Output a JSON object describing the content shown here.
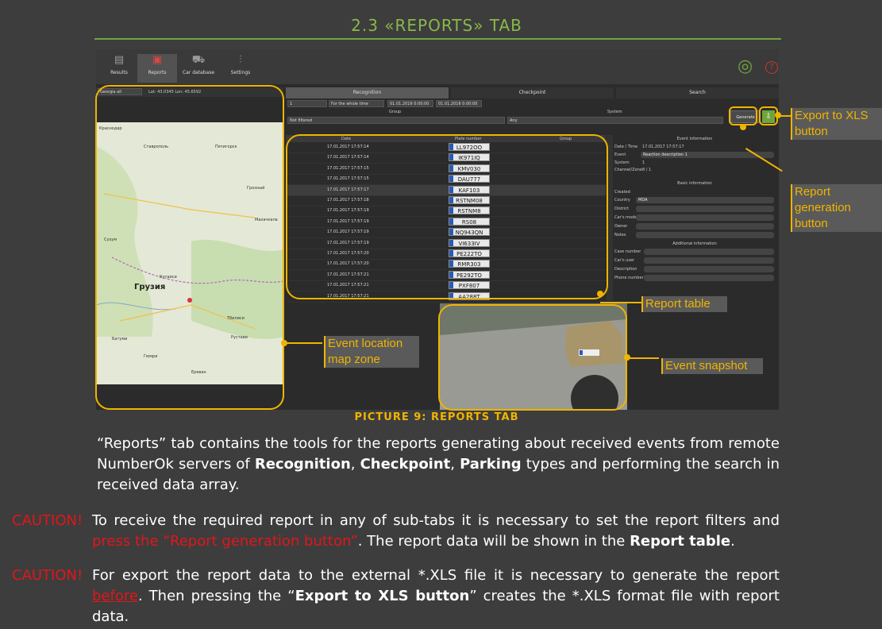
{
  "heading": "2.3 «REPORTS» TAB",
  "toolbar": {
    "items": [
      "Results",
      "Reports",
      "Car database",
      "Settings"
    ]
  },
  "map": {
    "region_select": "Georgia all",
    "coords": "Lat: 43.0345 Lon: 45.6592",
    "city_label": "Грузия",
    "places": [
      "Краснодар",
      "Ставрополь",
      "Пятигорск",
      "Грозный",
      "Махачкала",
      "Сухум",
      "Кутаиси",
      "Тбилиси",
      "Батуми",
      "Рустави",
      "Ереван",
      "Гюмри"
    ]
  },
  "tabs": [
    "Recognition",
    "Checkpoint",
    "Search"
  ],
  "filters": {
    "camera": "1",
    "period": "For the whole time",
    "date_from": "01.01.2016 0:00:00",
    "date_to": "01.01.2016 0:00:00",
    "group_label": "Group",
    "group_value": "Not filtered",
    "system_label": "System",
    "system_value": "Any",
    "generate_label": "Generate"
  },
  "table": {
    "columns": [
      "Date",
      "Plate number",
      "Group"
    ],
    "rows": [
      {
        "date": "17.01.2017 17:57:14",
        "plate": "LL972OO"
      },
      {
        "date": "17.01.2017 17:57:14",
        "plate": "IK971IQ"
      },
      {
        "date": "17.01.2017 17:57:15",
        "plate": "KMV030"
      },
      {
        "date": "17.01.2017 17:57:15",
        "plate": "DAU777"
      },
      {
        "date": "17.01.2017 17:57:17",
        "plate": "KAF103"
      },
      {
        "date": "17.01.2017 17:57:18",
        "plate": "RSTNM08"
      },
      {
        "date": "17.01.2017 17:57:19",
        "plate": "RSTNM8"
      },
      {
        "date": "17.01.2017 17:57:19",
        "plate": "RS08"
      },
      {
        "date": "17.01.2017 17:57:19",
        "plate": "NQ943QN"
      },
      {
        "date": "17.01.2017 17:57:19",
        "plate": "VI633IV"
      },
      {
        "date": "17.01.2017 17:57:20",
        "plate": "PE222TO"
      },
      {
        "date": "17.01.2017 17:57:20",
        "plate": "RMR303"
      },
      {
        "date": "17.01.2017 17:57:21",
        "plate": "PE292TO"
      },
      {
        "date": "17.01.2017 17:57:21",
        "plate": "PXF807"
      },
      {
        "date": "17.01.2017 17:57:21",
        "plate": "AA288T"
      }
    ]
  },
  "event_info": {
    "title": "Event information",
    "datetime_label": "Date / Time",
    "datetime_value": "17.01.2017 17:57:17",
    "event_label": "Event",
    "event_value": "Reaction description 1",
    "system_label": "System",
    "system_value": "1",
    "channel_label": "Channel/Zone",
    "channel_value": "8 / 1",
    "basic_title": "Basic information",
    "basic_fields": [
      "Created",
      "Country",
      "District",
      "Car's model",
      "Owner",
      "Notes"
    ],
    "country_value": "MDA",
    "additional_title": "Additional information",
    "additional_fields": [
      "Case number",
      "Car's user",
      "Description",
      "Phone number"
    ]
  },
  "callouts": {
    "export_xls": "Export to XLS button",
    "report_generation": "Report generation button",
    "report_table": "Report table",
    "map_zone": "Event location map zone",
    "snapshot": "Event snapshot"
  },
  "caption": "PICTURE 9: REPORTS TAB",
  "paragraph1": {
    "p1": "“Reports” tab contains the tools for the reports generating about received events from remote NumberOk servers of ",
    "b1": "Recognition",
    "p2": ", ",
    "b2": "Checkpoint",
    "p3": ", ",
    "b3": "Parking",
    "p4": " types and performing the search in received data array."
  },
  "caution1": {
    "label": "CAUTION!",
    "p1": " To receive the required report in any of sub-tabs it is necessary to set the report filters and ",
    "red": "press the “Report generation button”",
    "p2": ". The report data will be shown in the ",
    "b": "Report table",
    "p3": "."
  },
  "caution2": {
    "label": "CAUTION!",
    "p1": " For export the report data to the external *.XLS file it is necessary to generate the report ",
    "red": "before",
    "p2": ". Then pressing the “",
    "b": "Export to XLS button",
    "p3": "” creates the *.XLS format file with report data."
  },
  "colors": {
    "accent_green": "#6fa53c",
    "callout": "#f0b400",
    "caution": "#e0161b"
  }
}
